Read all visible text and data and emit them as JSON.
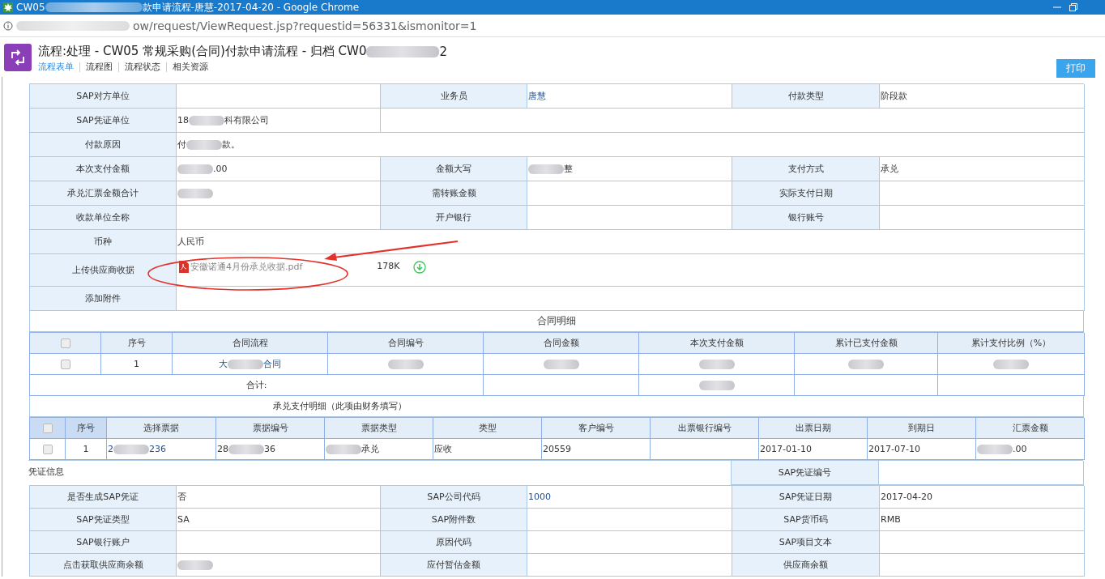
{
  "window": {
    "title": [
      "CW05 ",
      {
        "kind": "blur"
      },
      "款申请流程-唐慧-2017-04-20 - Google Chrome"
    ]
  },
  "address_bar": {
    "url": [
      {
        "kind": "blur"
      },
      "ow/request/ViewRequest.jsp?requestid=56331&ismonitor=1"
    ]
  },
  "header": {
    "title": [
      "流程:处理 - CW05 常规采购(合同)付款申请流程 - 归档 CW0",
      {
        "kind": "blur"
      },
      "2"
    ],
    "tabs": [
      {
        "label": "流程表单",
        "selected": true
      },
      {
        "label": "流程图",
        "selected": false
      },
      {
        "label": "流程状态",
        "selected": false
      },
      {
        "label": "相关资源",
        "selected": false
      }
    ],
    "print_button": "打印"
  },
  "form": {
    "rows": [
      {
        "cells": [
          {
            "kind": "label",
            "text": "SAP对方单位"
          },
          {
            "kind": "value"
          },
          {
            "kind": "label",
            "text": "业务员"
          },
          {
            "kind": "link",
            "value": "唐慧"
          },
          {
            "kind": "label",
            "text": "付款类型"
          },
          {
            "kind": "value",
            "value": "阶段款"
          }
        ]
      },
      {
        "cells": [
          {
            "kind": "label",
            "text": "SAP凭证单位"
          },
          {
            "kind": "value",
            "value": [
              "18",
              {
                "kind": "blur"
              },
              "科有限公司"
            ]
          },
          {
            "kind": "value"
          }
        ]
      },
      {
        "cells": [
          {
            "kind": "label",
            "text": "付款原因"
          },
          {
            "kind": "value",
            "value": [
              "付",
              {
                "kind": "blur"
              },
              "款。"
            ]
          }
        ]
      },
      {
        "cells": [
          {
            "kind": "label",
            "text": "本次支付金额"
          },
          {
            "kind": "value",
            "value": [
              {
                "kind": "blur"
              },
              ".00"
            ]
          },
          {
            "kind": "label",
            "text": "金额大写"
          },
          {
            "kind": "value",
            "value": [
              {
                "kind": "blur"
              },
              "整"
            ]
          },
          {
            "kind": "label",
            "text": "支付方式"
          },
          {
            "kind": "value",
            "value": "承兑"
          }
        ]
      },
      {
        "cells": [
          {
            "kind": "label",
            "text": "承兑汇票金额合计"
          },
          {
            "kind": "value",
            "value": [
              {
                "kind": "blur"
              }
            ]
          },
          {
            "kind": "label",
            "text": "需转账金额"
          },
          {
            "kind": "value"
          },
          {
            "kind": "label",
            "text": "实际支付日期"
          },
          {
            "kind": "value"
          }
        ]
      },
      {
        "cells": [
          {
            "kind": "label",
            "text": "收款单位全称"
          },
          {
            "kind": "value"
          },
          {
            "kind": "label",
            "text": "开户银行"
          },
          {
            "kind": "value"
          },
          {
            "kind": "label",
            "text": "银行账号"
          },
          {
            "kind": "value"
          }
        ]
      },
      {
        "cells": [
          {
            "kind": "label",
            "text": "币种"
          },
          {
            "kind": "value",
            "value": "人民币"
          }
        ]
      },
      {
        "cells": [
          {
            "kind": "label",
            "text": "上传供应商收据"
          },
          {
            "kind": "attachment",
            "file": "安徽诺通4月份承兑收据.pdf",
            "size": "178K"
          }
        ]
      },
      {
        "cells": [
          {
            "kind": "label",
            "text": "添加附件"
          },
          {
            "kind": "value"
          }
        ]
      }
    ]
  },
  "contract": {
    "title": "合同明细",
    "header_checked": false,
    "columns": [
      "序号",
      "合同流程",
      "合同编号",
      "合同金额",
      "本次支付金额",
      "累计已支付金额",
      "累计支付比例（%）"
    ],
    "rows": [
      {
        "checked": false,
        "cells": [
          "1",
          [
            "大",
            {
              "kind": "blur"
            },
            "合同"
          ],
          [
            {
              "kind": "blur"
            }
          ],
          [
            {
              "kind": "blur"
            }
          ],
          [
            {
              "kind": "blur"
            }
          ],
          [
            {
              "kind": "blur"
            }
          ],
          [
            {
              "kind": "blur"
            }
          ]
        ]
      }
    ],
    "total": {
      "label": "合计:",
      "this_payment": [
        {
          "kind": "blur"
        }
      ]
    }
  },
  "acceptance": {
    "title": "承兑支付明细（此项由财务填写）",
    "header_checked": false,
    "columns": [
      "序号",
      "选择票据",
      "票据编号",
      "票据类型",
      "类型",
      "客户编号",
      "出票银行编号",
      "出票日期",
      "到期日",
      "汇票金额"
    ],
    "rows": [
      {
        "checked": false,
        "cells": [
          "1",
          [
            "2",
            {
              "kind": "blur"
            },
            "236"
          ],
          [
            "28",
            {
              "kind": "blur"
            },
            "36"
          ],
          [
            {
              "kind": "blur"
            },
            "承兑"
          ],
          "应收",
          "20559",
          null,
          "2017-01-10",
          "2017-07-10",
          [
            {
              "kind": "blur"
            },
            ".00"
          ]
        ]
      }
    ]
  },
  "voucher": {
    "heading": "凭证信息",
    "number_label": "SAP凭证编号",
    "rows": [
      {
        "cells": [
          {
            "kind": "label",
            "text": "是否生成SAP凭证"
          },
          {
            "kind": "value",
            "value": "否"
          },
          {
            "kind": "label",
            "text": "SAP公司代码"
          },
          {
            "kind": "link",
            "value": "1000"
          },
          {
            "kind": "label",
            "text": "SAP凭证日期"
          },
          {
            "kind": "value",
            "value": "2017-04-20"
          }
        ]
      },
      {
        "cells": [
          {
            "kind": "label",
            "text": "SAP凭证类型"
          },
          {
            "kind": "value",
            "value": "SA"
          },
          {
            "kind": "label",
            "text": "SAP附件数"
          },
          {
            "kind": "value"
          },
          {
            "kind": "label",
            "text": "SAP货币码"
          },
          {
            "kind": "value",
            "value": "RMB"
          }
        ]
      },
      {
        "cells": [
          {
            "kind": "label",
            "text": "SAP银行账户"
          },
          {
            "kind": "value"
          },
          {
            "kind": "label",
            "text": "原因代码"
          },
          {
            "kind": "value"
          },
          {
            "kind": "label",
            "text": "SAP项目文本"
          },
          {
            "kind": "value"
          }
        ]
      },
      {
        "cells": [
          {
            "kind": "label",
            "text": "点击获取供应商余额"
          },
          {
            "kind": "value",
            "value": [
              {
                "kind": "blur"
              }
            ]
          },
          {
            "kind": "label",
            "text": "应付暂估金额"
          },
          {
            "kind": "value"
          },
          {
            "kind": "label",
            "text": "供应商余额"
          },
          {
            "kind": "value"
          }
        ]
      }
    ]
  }
}
